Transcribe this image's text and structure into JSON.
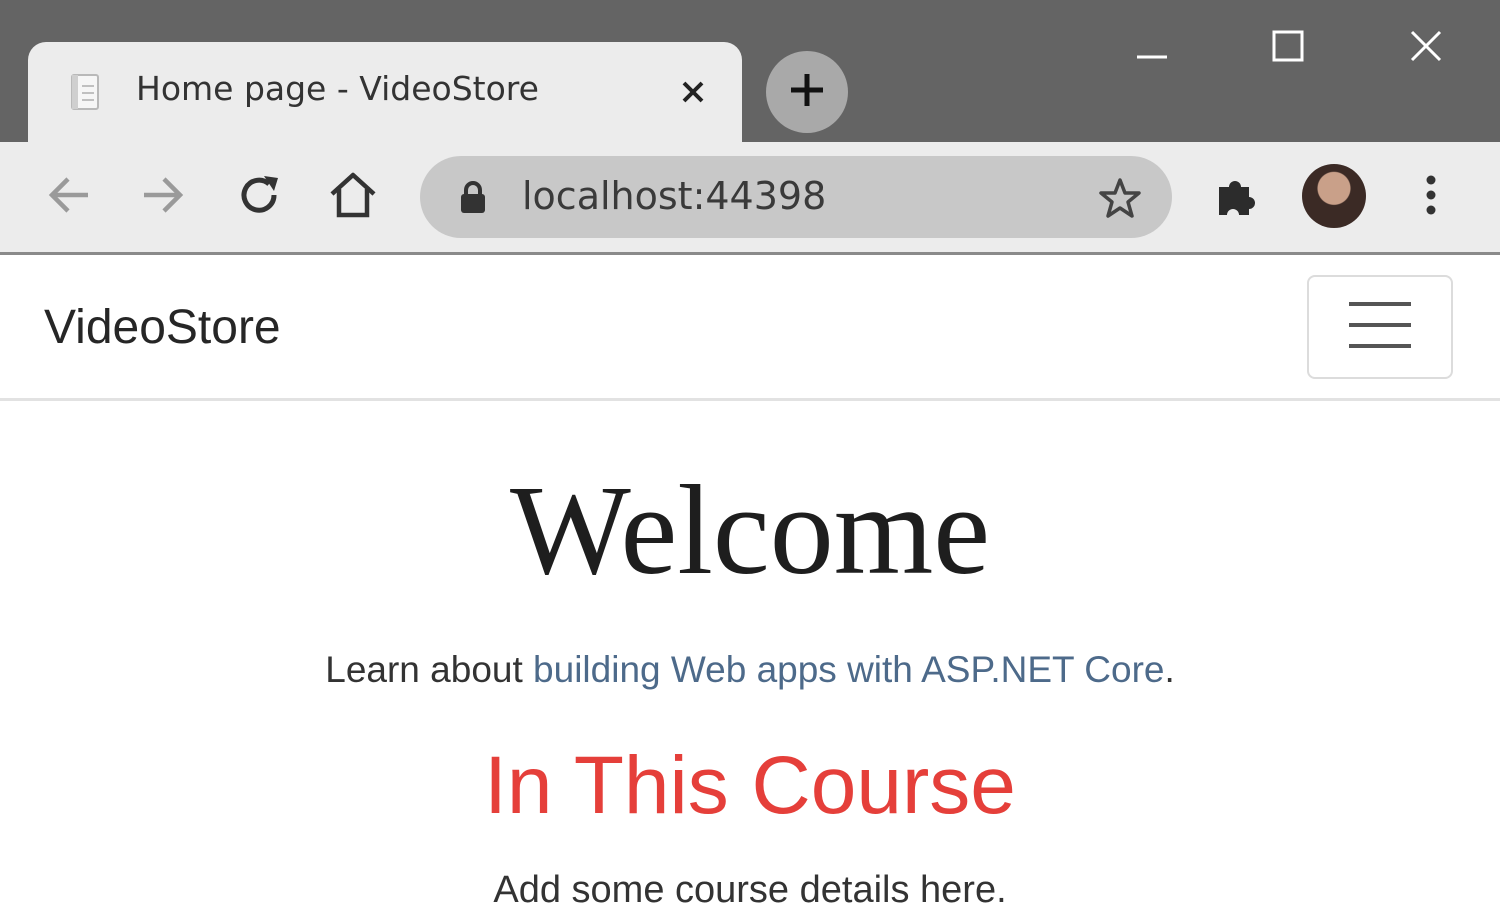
{
  "browser": {
    "tab": {
      "title": "Home page - VideoStore",
      "favicon": "page-icon",
      "close_icon": "close-icon"
    },
    "new_tab_icon": "plus-icon",
    "window_controls": [
      "minimize-icon",
      "maximize-icon",
      "close-icon"
    ],
    "toolbar": {
      "back_icon": "back-arrow-icon",
      "forward_icon": "forward-arrow-icon",
      "reload_icon": "reload-icon",
      "home_icon": "home-icon",
      "url": "localhost:44398",
      "lock_icon": "lock-icon",
      "bookmark_icon": "star-icon",
      "extensions_icon": "puzzle-icon",
      "profile_icon": "avatar",
      "menu_icon": "kebab-menu-icon"
    }
  },
  "page": {
    "navbar": {
      "brand": "VideoStore",
      "toggler_icon": "hamburger-icon"
    },
    "heading": "Welcome",
    "learn_prefix": "Learn about ",
    "learn_link": "building Web apps with ASP.NET Core",
    "learn_suffix": ".",
    "subheading": "In This Course",
    "details": "Add some course details here."
  },
  "colors": {
    "tabstrip": "#646464",
    "toolbar": "#ececec",
    "omnibox": "#c8c8c8",
    "link": "#4d6a8a",
    "course_heading": "#e53f3a"
  }
}
